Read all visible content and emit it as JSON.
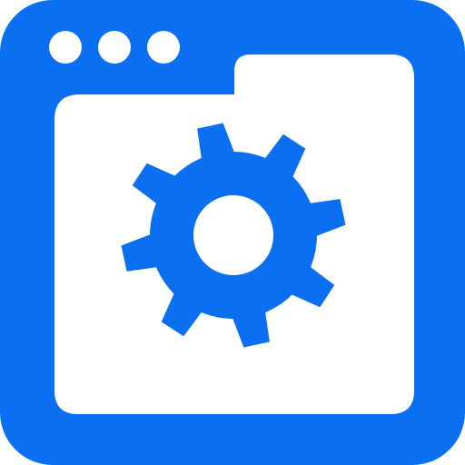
{
  "icon": {
    "name": "browser-window-settings-icon",
    "glyph": "gear-icon",
    "window_dots": 3
  },
  "colors": {
    "accent": "#0A6FF0",
    "background": "#FFFFFF"
  }
}
